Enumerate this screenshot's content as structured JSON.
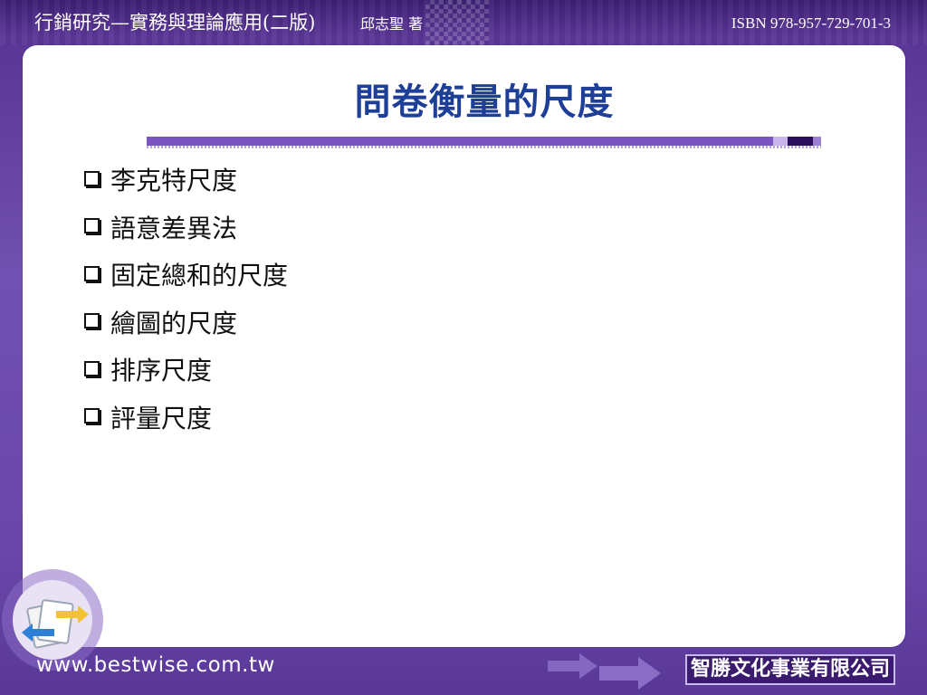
{
  "header": {
    "book_title": "行銷研究—實務與理論應用(二版)",
    "author": "邱志聖  著",
    "isbn": "ISBN 978-957-729-701-3"
  },
  "slide": {
    "title": "問卷衡量的尺度",
    "bullets": [
      "李克特尺度",
      "語意差異法",
      "固定總和的尺度",
      "繪圖的尺度",
      "排序尺度",
      "評量尺度"
    ]
  },
  "footer": {
    "url": "www.bestwise.com.tw",
    "publisher": "智勝文化事業有限公司"
  },
  "icons": {
    "bullet": "checkbox-square-icon",
    "nav": "back-forward-arrows-icon",
    "decor": "double-arrow-icon"
  },
  "colors": {
    "background": "#6a45a8",
    "title": "#1e3f97",
    "rule": "#7a55c0",
    "publisher_bg": "#3a1b6e"
  }
}
